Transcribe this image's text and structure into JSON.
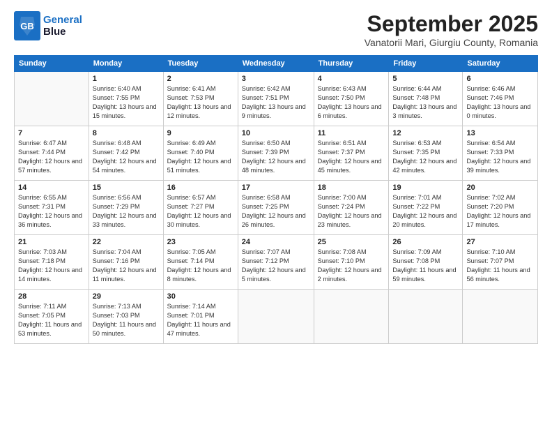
{
  "logo": {
    "line1": "General",
    "line2": "Blue"
  },
  "title": "September 2025",
  "subtitle": "Vanatorii Mari, Giurgiu County, Romania",
  "weekdays": [
    "Sunday",
    "Monday",
    "Tuesday",
    "Wednesday",
    "Thursday",
    "Friday",
    "Saturday"
  ],
  "weeks": [
    [
      {
        "day": "",
        "sunrise": "",
        "sunset": "",
        "daylight": ""
      },
      {
        "day": "1",
        "sunrise": "Sunrise: 6:40 AM",
        "sunset": "Sunset: 7:55 PM",
        "daylight": "Daylight: 13 hours and 15 minutes."
      },
      {
        "day": "2",
        "sunrise": "Sunrise: 6:41 AM",
        "sunset": "Sunset: 7:53 PM",
        "daylight": "Daylight: 13 hours and 12 minutes."
      },
      {
        "day": "3",
        "sunrise": "Sunrise: 6:42 AM",
        "sunset": "Sunset: 7:51 PM",
        "daylight": "Daylight: 13 hours and 9 minutes."
      },
      {
        "day": "4",
        "sunrise": "Sunrise: 6:43 AM",
        "sunset": "Sunset: 7:50 PM",
        "daylight": "Daylight: 13 hours and 6 minutes."
      },
      {
        "day": "5",
        "sunrise": "Sunrise: 6:44 AM",
        "sunset": "Sunset: 7:48 PM",
        "daylight": "Daylight: 13 hours and 3 minutes."
      },
      {
        "day": "6",
        "sunrise": "Sunrise: 6:46 AM",
        "sunset": "Sunset: 7:46 PM",
        "daylight": "Daylight: 13 hours and 0 minutes."
      }
    ],
    [
      {
        "day": "7",
        "sunrise": "Sunrise: 6:47 AM",
        "sunset": "Sunset: 7:44 PM",
        "daylight": "Daylight: 12 hours and 57 minutes."
      },
      {
        "day": "8",
        "sunrise": "Sunrise: 6:48 AM",
        "sunset": "Sunset: 7:42 PM",
        "daylight": "Daylight: 12 hours and 54 minutes."
      },
      {
        "day": "9",
        "sunrise": "Sunrise: 6:49 AM",
        "sunset": "Sunset: 7:40 PM",
        "daylight": "Daylight: 12 hours and 51 minutes."
      },
      {
        "day": "10",
        "sunrise": "Sunrise: 6:50 AM",
        "sunset": "Sunset: 7:39 PM",
        "daylight": "Daylight: 12 hours and 48 minutes."
      },
      {
        "day": "11",
        "sunrise": "Sunrise: 6:51 AM",
        "sunset": "Sunset: 7:37 PM",
        "daylight": "Daylight: 12 hours and 45 minutes."
      },
      {
        "day": "12",
        "sunrise": "Sunrise: 6:53 AM",
        "sunset": "Sunset: 7:35 PM",
        "daylight": "Daylight: 12 hours and 42 minutes."
      },
      {
        "day": "13",
        "sunrise": "Sunrise: 6:54 AM",
        "sunset": "Sunset: 7:33 PM",
        "daylight": "Daylight: 12 hours and 39 minutes."
      }
    ],
    [
      {
        "day": "14",
        "sunrise": "Sunrise: 6:55 AM",
        "sunset": "Sunset: 7:31 PM",
        "daylight": "Daylight: 12 hours and 36 minutes."
      },
      {
        "day": "15",
        "sunrise": "Sunrise: 6:56 AM",
        "sunset": "Sunset: 7:29 PM",
        "daylight": "Daylight: 12 hours and 33 minutes."
      },
      {
        "day": "16",
        "sunrise": "Sunrise: 6:57 AM",
        "sunset": "Sunset: 7:27 PM",
        "daylight": "Daylight: 12 hours and 30 minutes."
      },
      {
        "day": "17",
        "sunrise": "Sunrise: 6:58 AM",
        "sunset": "Sunset: 7:25 PM",
        "daylight": "Daylight: 12 hours and 26 minutes."
      },
      {
        "day": "18",
        "sunrise": "Sunrise: 7:00 AM",
        "sunset": "Sunset: 7:24 PM",
        "daylight": "Daylight: 12 hours and 23 minutes."
      },
      {
        "day": "19",
        "sunrise": "Sunrise: 7:01 AM",
        "sunset": "Sunset: 7:22 PM",
        "daylight": "Daylight: 12 hours and 20 minutes."
      },
      {
        "day": "20",
        "sunrise": "Sunrise: 7:02 AM",
        "sunset": "Sunset: 7:20 PM",
        "daylight": "Daylight: 12 hours and 17 minutes."
      }
    ],
    [
      {
        "day": "21",
        "sunrise": "Sunrise: 7:03 AM",
        "sunset": "Sunset: 7:18 PM",
        "daylight": "Daylight: 12 hours and 14 minutes."
      },
      {
        "day": "22",
        "sunrise": "Sunrise: 7:04 AM",
        "sunset": "Sunset: 7:16 PM",
        "daylight": "Daylight: 12 hours and 11 minutes."
      },
      {
        "day": "23",
        "sunrise": "Sunrise: 7:05 AM",
        "sunset": "Sunset: 7:14 PM",
        "daylight": "Daylight: 12 hours and 8 minutes."
      },
      {
        "day": "24",
        "sunrise": "Sunrise: 7:07 AM",
        "sunset": "Sunset: 7:12 PM",
        "daylight": "Daylight: 12 hours and 5 minutes."
      },
      {
        "day": "25",
        "sunrise": "Sunrise: 7:08 AM",
        "sunset": "Sunset: 7:10 PM",
        "daylight": "Daylight: 12 hours and 2 minutes."
      },
      {
        "day": "26",
        "sunrise": "Sunrise: 7:09 AM",
        "sunset": "Sunset: 7:08 PM",
        "daylight": "Daylight: 11 hours and 59 minutes."
      },
      {
        "day": "27",
        "sunrise": "Sunrise: 7:10 AM",
        "sunset": "Sunset: 7:07 PM",
        "daylight": "Daylight: 11 hours and 56 minutes."
      }
    ],
    [
      {
        "day": "28",
        "sunrise": "Sunrise: 7:11 AM",
        "sunset": "Sunset: 7:05 PM",
        "daylight": "Daylight: 11 hours and 53 minutes."
      },
      {
        "day": "29",
        "sunrise": "Sunrise: 7:13 AM",
        "sunset": "Sunset: 7:03 PM",
        "daylight": "Daylight: 11 hours and 50 minutes."
      },
      {
        "day": "30",
        "sunrise": "Sunrise: 7:14 AM",
        "sunset": "Sunset: 7:01 PM",
        "daylight": "Daylight: 11 hours and 47 minutes."
      },
      {
        "day": "",
        "sunrise": "",
        "sunset": "",
        "daylight": ""
      },
      {
        "day": "",
        "sunrise": "",
        "sunset": "",
        "daylight": ""
      },
      {
        "day": "",
        "sunrise": "",
        "sunset": "",
        "daylight": ""
      },
      {
        "day": "",
        "sunrise": "",
        "sunset": "",
        "daylight": ""
      }
    ]
  ]
}
